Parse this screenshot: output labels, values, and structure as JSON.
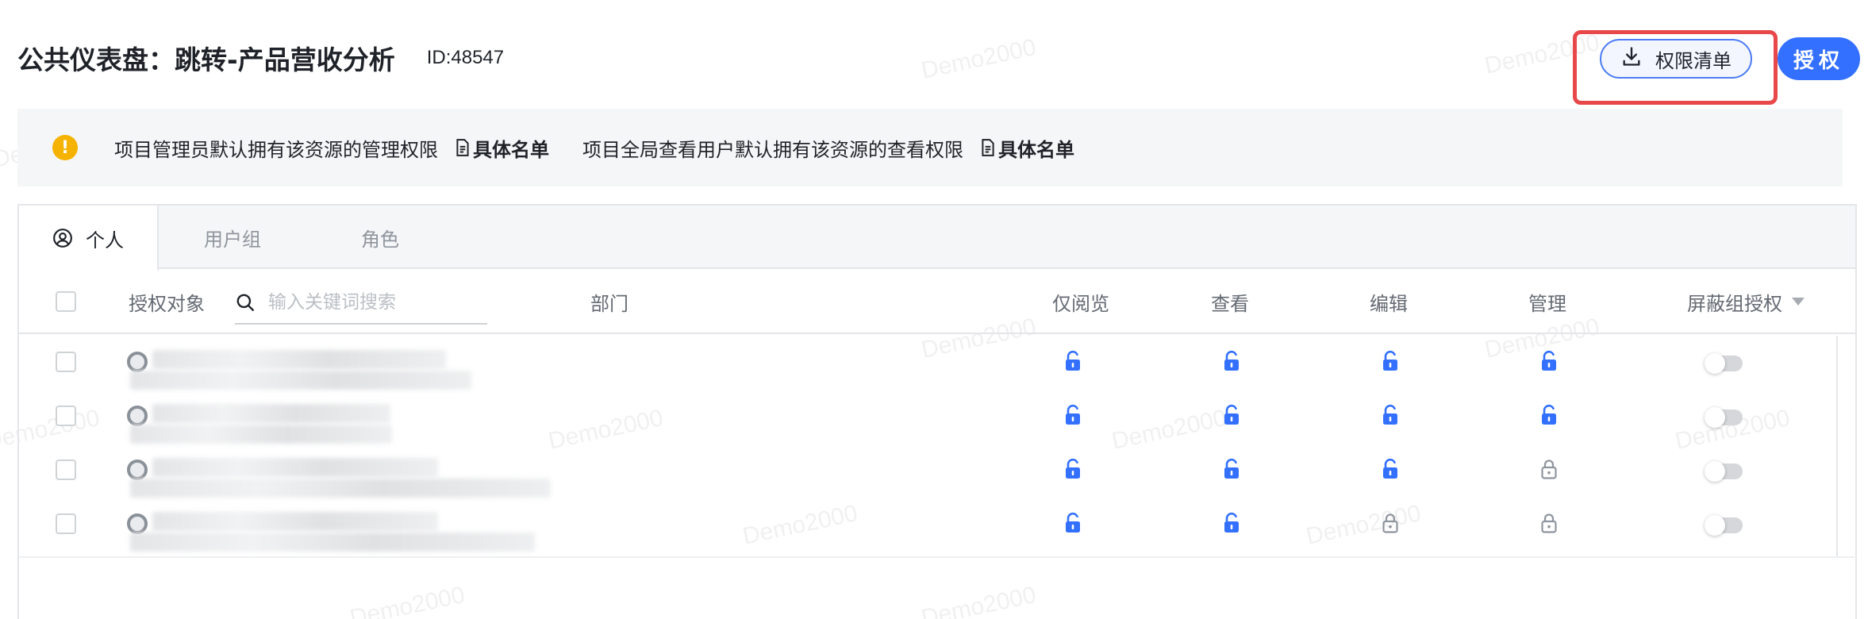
{
  "dashboard": {
    "title": "公共仪表盘：跳转-产品营收分析",
    "id_label": "ID:48547"
  },
  "actions": {
    "download_label": "权限清单",
    "authorize_label": "授权"
  },
  "notice": {
    "text1": "项目管理员默认拥有该资源的管理权限",
    "link1": "具体名单",
    "text2": "项目全局查看用户默认拥有该资源的查看权限",
    "link2": "具体名单"
  },
  "tabs": [
    {
      "label": "个人",
      "active": true
    },
    {
      "label": "用户组",
      "active": false
    },
    {
      "label": "角色",
      "active": false
    }
  ],
  "table": {
    "columns": {
      "subject": "授权对象",
      "department": "部门",
      "view_only": "仅阅览",
      "view": "查看",
      "edit": "编辑",
      "manage": "管理",
      "block_group": "屏蔽组授权"
    },
    "search_placeholder": "输入关键词搜索",
    "rows": [
      {
        "view_only": "unlocked",
        "view": "unlocked",
        "edit": "unlocked",
        "manage": "unlocked",
        "block_group": false
      },
      {
        "view_only": "unlocked",
        "view": "unlocked",
        "edit": "unlocked",
        "manage": "unlocked",
        "block_group": false
      },
      {
        "view_only": "unlocked",
        "view": "unlocked",
        "edit": "unlocked",
        "manage": "locked",
        "block_group": false
      },
      {
        "view_only": "unlocked",
        "view": "unlocked",
        "edit": "locked",
        "manage": "locked",
        "block_group": false
      }
    ]
  },
  "watermark": "Demo2000",
  "colors": {
    "primary": "#3370ff",
    "highlight": "#e8484a",
    "warning": "#f5b300",
    "locked": "#8f959e"
  },
  "icons": {
    "download": "download-icon",
    "warning": "warning-icon",
    "doc": "document-icon",
    "user": "user-circle-icon",
    "search": "search-icon",
    "unlocked": "unlock-icon",
    "locked": "lock-icon"
  }
}
